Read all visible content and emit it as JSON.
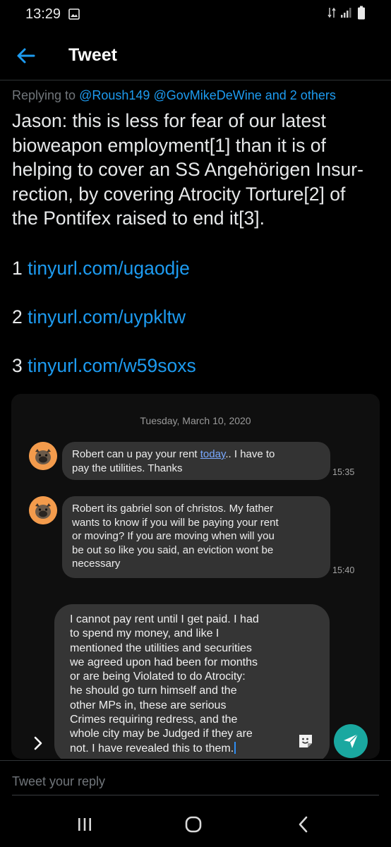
{
  "status_bar": {
    "time": "13:29",
    "icons": [
      "gallery-icon",
      "data-transfer-icon",
      "signal-icon",
      "battery-icon"
    ]
  },
  "header": {
    "title": "Tweet",
    "back_icon": "arrow-left-icon"
  },
  "tweet": {
    "replying_prefix": "Replying to",
    "mention_1": "@Roush149",
    "mention_2": "@GovMikeDeWine",
    "mention_suffix": "and 2 others",
    "text_lines": [
      "Jason: this is less for fear of our latest",
      "bioweapon employment[1] than it is of",
      "helping to cover an SS Angehörigen Insur-",
      "rection, by covering Atrocity Torture[2] of",
      "the Pontifex raised to end it[3]."
    ],
    "links": [
      {
        "num": "1",
        "url": "tinyurl.com/ugaodje"
      },
      {
        "num": "2",
        "url": "tinyurl.com/uypkltw"
      },
      {
        "num": "3",
        "url": "tinyurl.com/w59soxs"
      }
    ]
  },
  "media": {
    "date": "Tuesday, March 10, 2020",
    "messages": [
      {
        "line1_before": "Robert can u pay your rent ",
        "line1_link": "today",
        "line1_after": ".. I have to",
        "line2": "pay the utilities. Thanks",
        "time": "15:35"
      },
      {
        "lines": [
          "Robert its gabriel son of christos. My father",
          "wants to know if you will be paying your rent",
          "or moving? If you are moving when will you",
          "be out so like you said, an eviction wont be",
          "necessary"
        ],
        "time": "15:40"
      }
    ],
    "draft_lines": [
      "I cannot pay rent until I get paid. I had",
      "to spend my money, and like I",
      "mentioned the utilities and securities",
      "we agreed upon had been for months",
      "or are being Violated to do Atrocity:",
      "he should go turn himself and the",
      "other MPs in, these are serious",
      "Crimes requiring redress, and the",
      "whole city may be Judged if they are",
      "not. I have revealed this to them."
    ],
    "icons": [
      "chevron-right-icon",
      "sticker-icon",
      "send-icon"
    ],
    "colors": {
      "avatar": "#f39b4c",
      "send_button": "#1aa8a0",
      "bubble": "#333333"
    }
  },
  "reply": {
    "placeholder": "Tweet your reply"
  },
  "navbar": {
    "icons": [
      "recent-apps-icon",
      "home-icon",
      "back-icon"
    ]
  },
  "colors": {
    "accent": "#1d9bf0",
    "background": "#000000",
    "muted_text": "#71767b"
  }
}
